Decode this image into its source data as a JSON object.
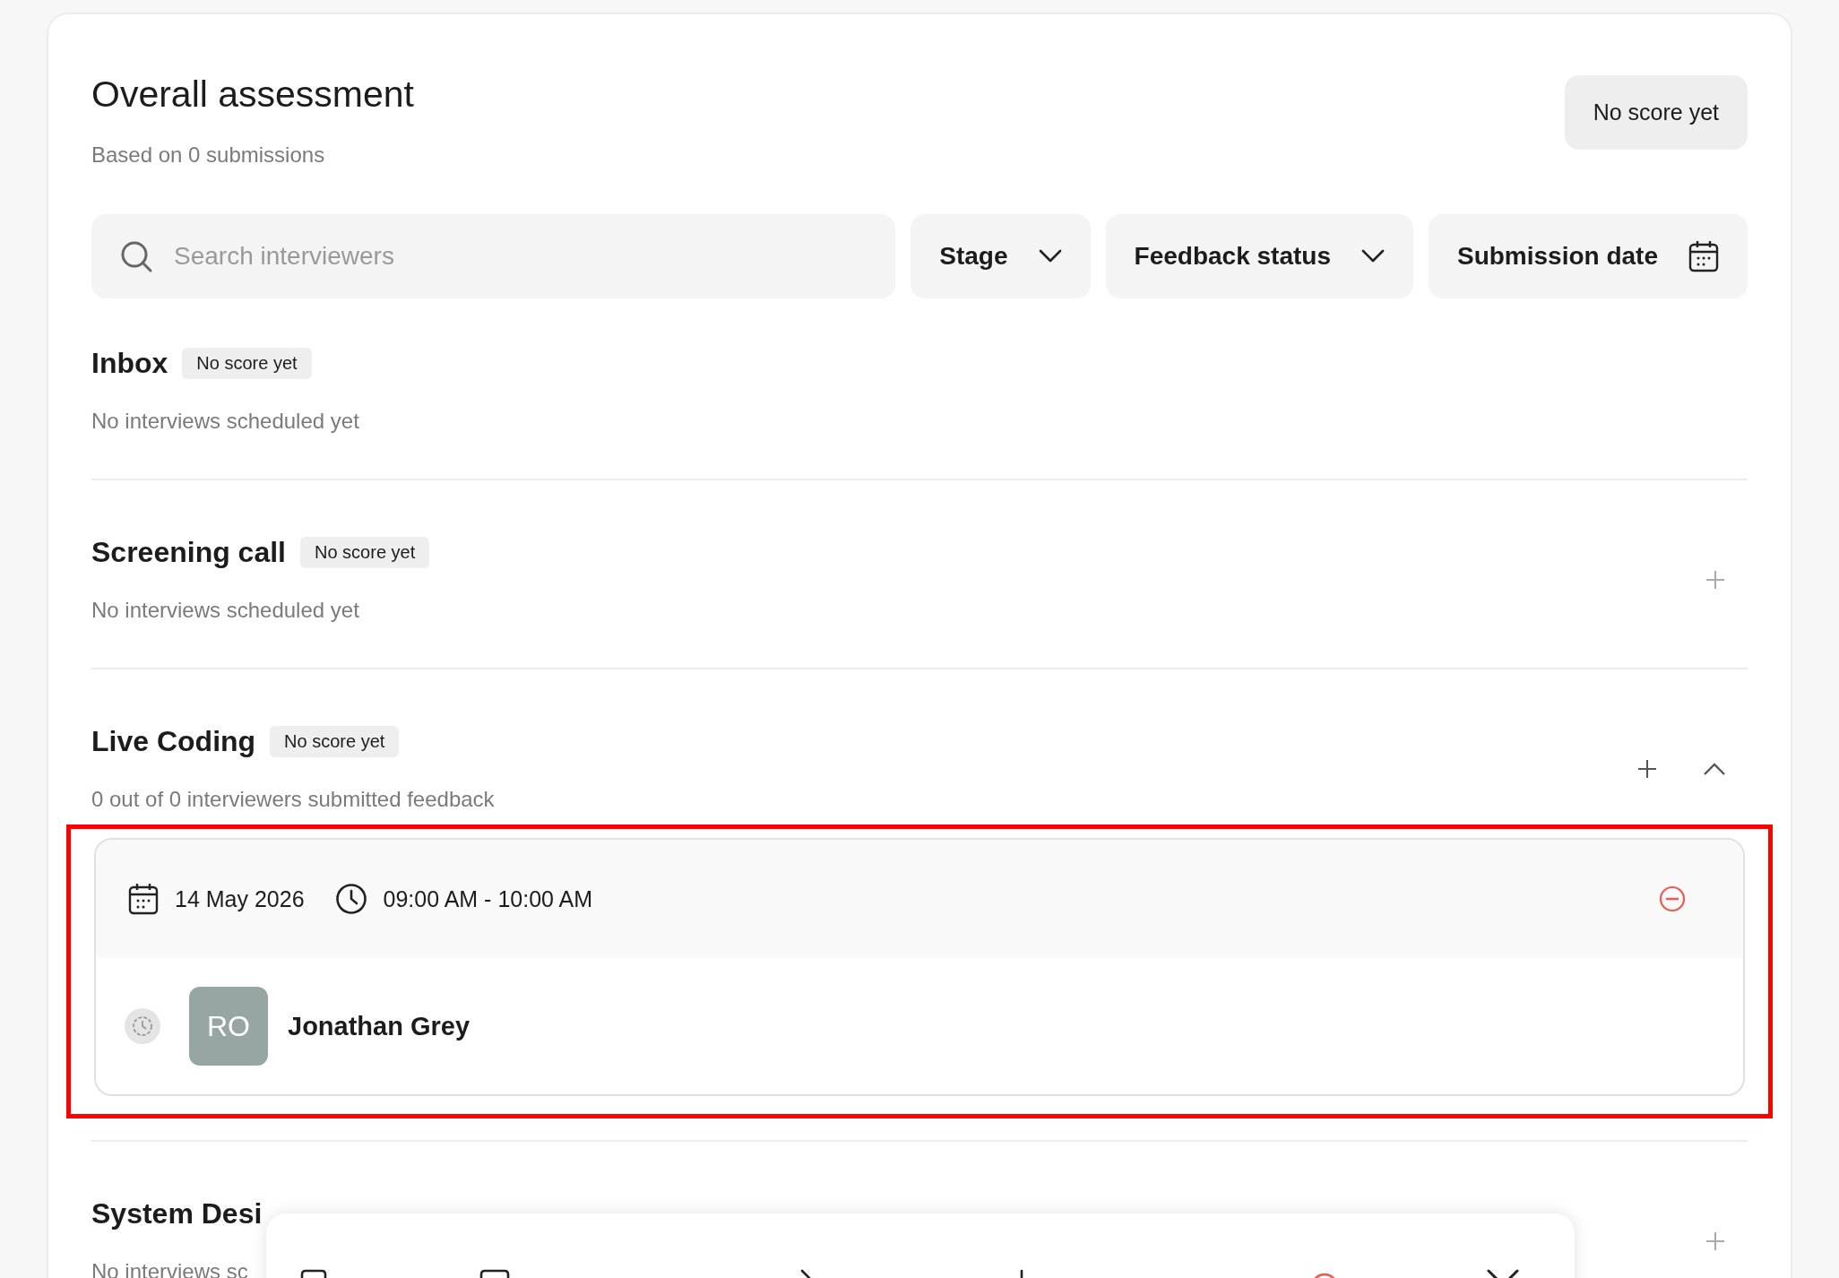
{
  "header": {
    "title": "Overall assessment",
    "subtitle": "Based on 0 submissions",
    "score_badge": "No score yet"
  },
  "filters": {
    "search": {
      "placeholder": "Search interviewers"
    },
    "controls": [
      {
        "label": "Stage",
        "kind": "dropdown"
      },
      {
        "label": "Feedback status",
        "kind": "dropdown"
      },
      {
        "label": "Submission date",
        "kind": "date"
      }
    ]
  },
  "stages": [
    {
      "name": "Inbox",
      "badge": "No score yet",
      "summary": "No interviews scheduled yet",
      "can_add": false,
      "expanded": false
    },
    {
      "name": "Screening call",
      "badge": "No score yet",
      "summary": "No interviews scheduled yet",
      "can_add": true,
      "expanded": false
    },
    {
      "name": "Live Coding",
      "badge": "No score yet",
      "summary": "0 out of 0 interviewers submitted feedback",
      "can_add": true,
      "expanded": true,
      "interviews": [
        {
          "date": "14 May 2026",
          "time": "09:00 AM - 10:00 AM",
          "highlighted": true,
          "interviewers": [
            {
              "initials": "RO",
              "name": "Jonathan Grey"
            }
          ]
        }
      ]
    },
    {
      "name": "System Desi",
      "summary": "No interviews sc",
      "can_add": true,
      "expanded": false
    }
  ]
}
